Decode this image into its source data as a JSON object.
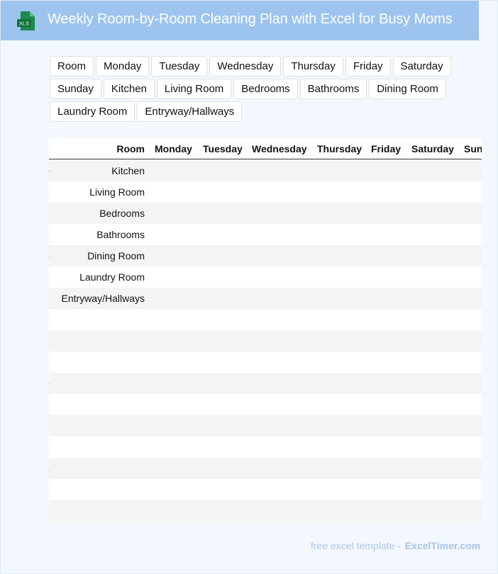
{
  "header": {
    "icon": "xls-file-icon",
    "icon_label": "XLS",
    "title": "Weekly Room-by-Room Cleaning Plan with Excel for Busy Moms",
    "background": "#9cc4ee"
  },
  "chips": [
    "Room",
    "Monday",
    "Tuesday",
    "Wednesday",
    "Thursday",
    "Friday",
    "Saturday",
    "Sunday",
    "Kitchen",
    "Living Room",
    "Bedrooms",
    "Bathrooms",
    "Dining Room",
    "Laundry Room",
    "Entryway/Hallways"
  ],
  "table": {
    "columns": [
      "Room",
      "Monday",
      "Tuesday",
      "Wednesday",
      "Thursday",
      "Friday",
      "Saturday",
      "Sun"
    ],
    "rows": [
      {
        "index": "0",
        "room": "Kitchen"
      },
      {
        "index": "1",
        "room": "Living Room"
      },
      {
        "index": "2",
        "room": "Bedrooms"
      },
      {
        "index": "3",
        "room": "Bathrooms"
      },
      {
        "index": "4",
        "room": "Dining Room"
      },
      {
        "index": "5",
        "room": "Laundry Room"
      },
      {
        "index": "6",
        "room": "Entryway/Hallways"
      },
      {
        "index": "7",
        "room": ""
      },
      {
        "index": "8",
        "room": ""
      },
      {
        "index": "9",
        "room": ""
      },
      {
        "index": "0",
        "room": ""
      },
      {
        "index": "1",
        "room": ""
      },
      {
        "index": "2",
        "room": ""
      },
      {
        "index": "3",
        "room": ""
      },
      {
        "index": "4",
        "room": ""
      },
      {
        "index": "5",
        "room": ""
      },
      {
        "index": "6",
        "room": ""
      }
    ]
  },
  "footer": {
    "prefix": "free excel template -",
    "brand": "ExcelTimer.com"
  }
}
